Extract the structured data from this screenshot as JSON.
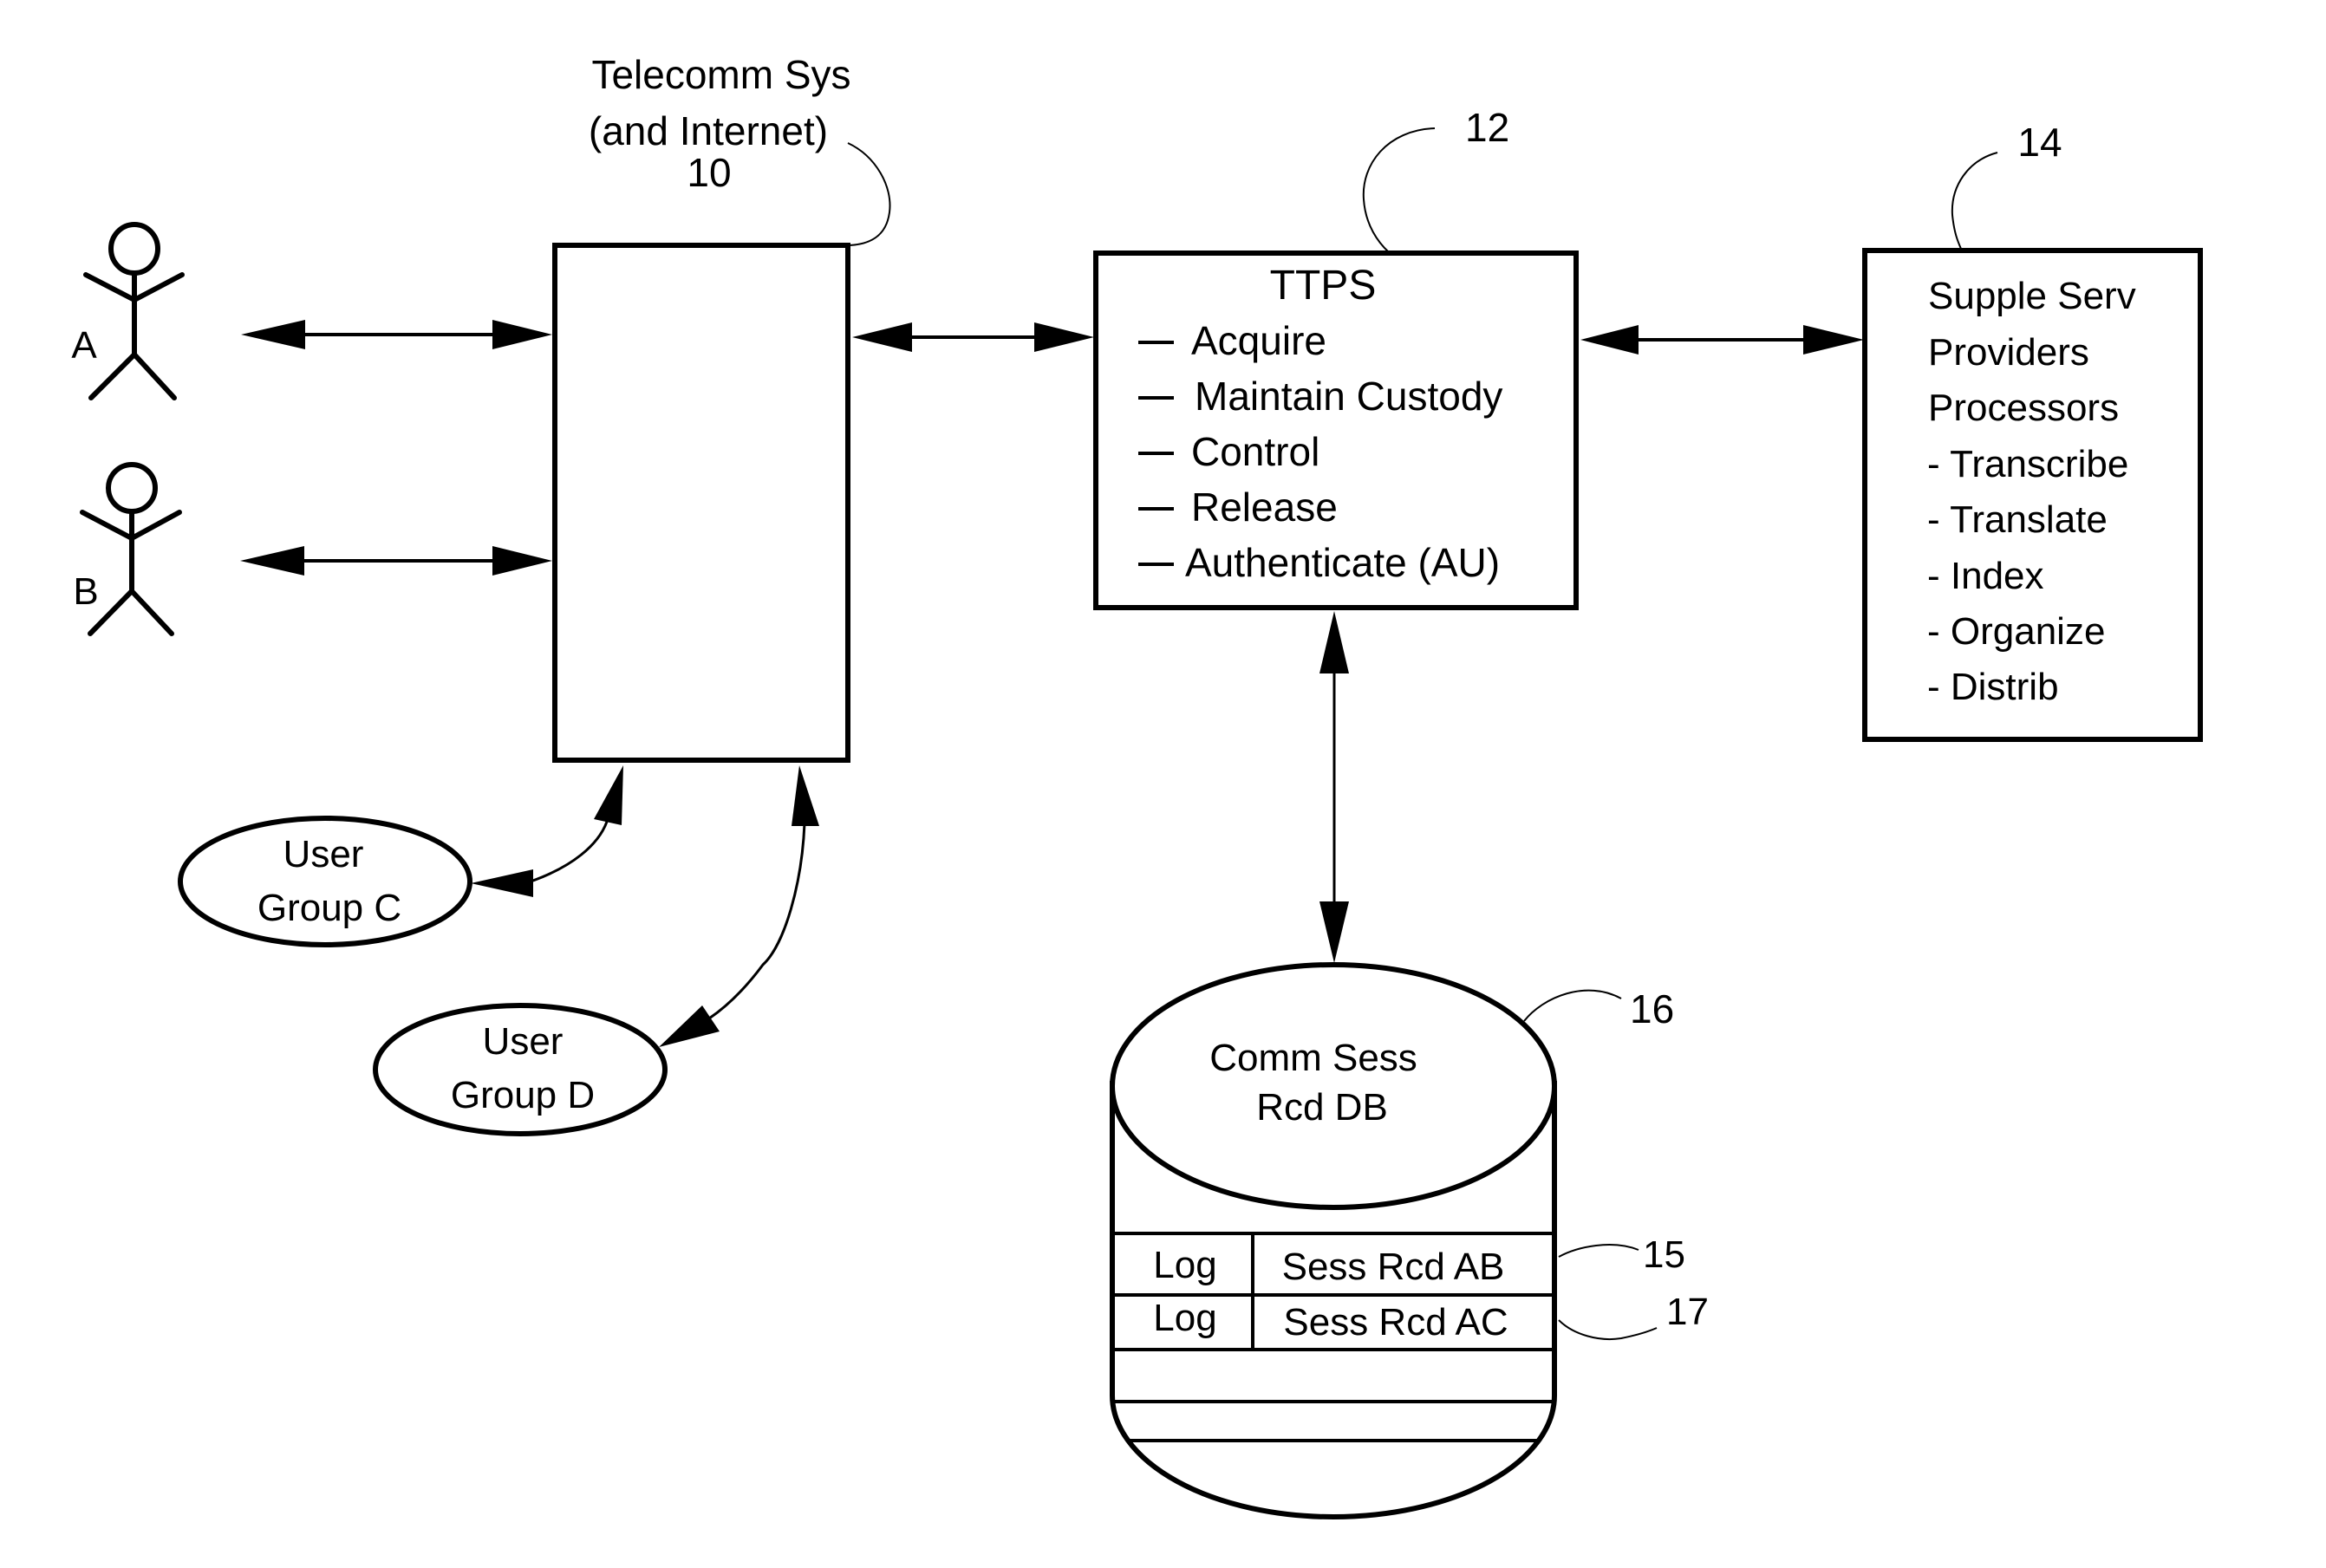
{
  "diagram": {
    "actors": [
      {
        "id": "A",
        "label": "A"
      },
      {
        "id": "B",
        "label": "B"
      }
    ],
    "telecomm": {
      "title_line1": "Telecomm Sys",
      "title_line2": "(and Internet)",
      "ref": "10"
    },
    "ttps": {
      "title": "TTPS",
      "ref": "12",
      "dash": "—",
      "items": [
        "Acquire",
        "Maintain Custody",
        "Control",
        "Release",
        "Authenticate (AU)"
      ]
    },
    "supple": {
      "ref": "14",
      "lines": [
        "Supple Serv",
        "Providers",
        "Processors"
      ],
      "items": [
        "- Transcribe",
        "- Translate",
        "- Index",
        "- Organize",
        "- Distrib"
      ]
    },
    "user_groups": [
      {
        "line1": "User",
        "line2": "Group C"
      },
      {
        "line1": "User",
        "line2": "Group D"
      }
    ],
    "database": {
      "ref": "16",
      "title_line1": "Comm Sess",
      "title_line2": "Rcd DB",
      "rows": [
        {
          "log": "Log",
          "record": "Sess Rcd AB",
          "ref": "15"
        },
        {
          "log": "Log",
          "record": "Sess Rcd AC",
          "ref": "17"
        }
      ]
    }
  }
}
